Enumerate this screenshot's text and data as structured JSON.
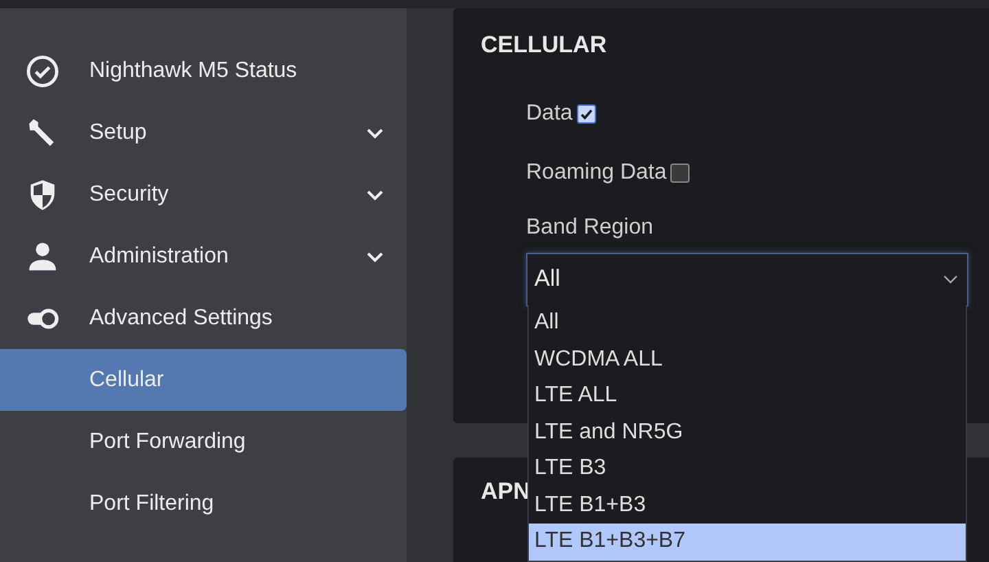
{
  "sidebar": {
    "items": [
      {
        "label": "Nighthawk M5 Status",
        "expandable": false,
        "selected": false
      },
      {
        "label": "Setup",
        "expandable": true,
        "selected": false
      },
      {
        "label": "Security",
        "expandable": true,
        "selected": false
      },
      {
        "label": "Administration",
        "expandable": true,
        "selected": false
      },
      {
        "label": "Advanced Settings",
        "expandable": false,
        "selected": false
      },
      {
        "label": "Cellular",
        "selected": true
      },
      {
        "label": "Port Forwarding",
        "selected": false
      },
      {
        "label": "Port Filtering",
        "selected": false
      }
    ]
  },
  "cellular": {
    "title": "CELLULAR",
    "checkboxes": [
      {
        "label": "Data",
        "checked": true
      },
      {
        "label": "Roaming Data",
        "checked": false
      }
    ],
    "band_region": {
      "label": "Band Region",
      "value": "All",
      "expanded": true,
      "options": [
        {
          "label": "All",
          "highlighted": false
        },
        {
          "label": "WCDMA ALL",
          "highlighted": false
        },
        {
          "label": "LTE ALL",
          "highlighted": false
        },
        {
          "label": "LTE and NR5G",
          "highlighted": false
        },
        {
          "label": "LTE B3",
          "highlighted": false
        },
        {
          "label": "LTE B1+B3",
          "highlighted": false
        },
        {
          "label": "LTE B1+B3+B7",
          "highlighted": true
        }
      ]
    }
  },
  "apn": {
    "title": "APN"
  }
}
